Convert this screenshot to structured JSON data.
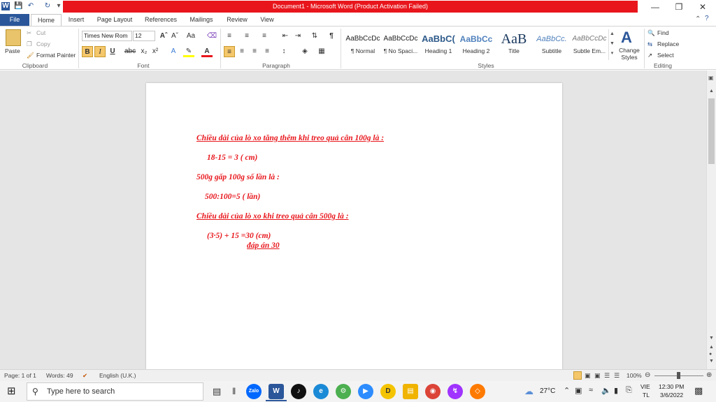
{
  "window": {
    "title": "Document1 - Microsoft Word (Product Activation Failed)"
  },
  "tabs": [
    "File",
    "Home",
    "Insert",
    "Page Layout",
    "References",
    "Mailings",
    "Review",
    "View"
  ],
  "clipboard": {
    "paste": "Paste",
    "cut": "Cut",
    "copy": "Copy",
    "format_painter": "Format Painter",
    "label": "Clipboard"
  },
  "font": {
    "name": "Times New Rom",
    "size": "12",
    "label": "Font"
  },
  "paragraph": {
    "label": "Paragraph"
  },
  "styles": {
    "label": "Styles",
    "items": [
      {
        "sample": "AaBbCcDc",
        "name": "¶ Normal"
      },
      {
        "sample": "AaBbCcDc",
        "name": "¶ No Spaci..."
      },
      {
        "sample": "AaBbC(",
        "name": "Heading 1"
      },
      {
        "sample": "AaBbCc",
        "name": "Heading 2"
      },
      {
        "sample": "AaB",
        "name": "Title"
      },
      {
        "sample": "AaBbCc.",
        "name": "Subtitle"
      },
      {
        "sample": "AaBbCcDc",
        "name": "Subtle Em..."
      }
    ],
    "change_styles": "Change Styles"
  },
  "editing": {
    "find": "Find",
    "replace": "Replace",
    "select": "Select",
    "label": "Editing"
  },
  "document": {
    "lines": [
      "Chiều dài của lò xo tăng thêm khi treo quả cân 100g là :",
      "18-15 = 3 ( cm)",
      "500g gấp 100g số lần là :",
      "500:100=5 ( lần)",
      "Chiều dài của lò xo khi treo quả cân 500g là :",
      "(3·5) + 15 =30 (cm)",
      "đáp án 30"
    ]
  },
  "status": {
    "page": "Page: 1 of 1",
    "words": "Words: 49",
    "language": "English (U.K.)",
    "zoom": "100%"
  },
  "taskbar": {
    "search_placeholder": "Type here to search",
    "temperature": "27°C",
    "lang1": "VIE",
    "lang2": "TL",
    "time": "12:30 PM",
    "date": "3/6/2022"
  },
  "colors": {
    "accent": "#2b579a",
    "title_bar": "#e8161c",
    "doc_text": "#e8161c"
  }
}
